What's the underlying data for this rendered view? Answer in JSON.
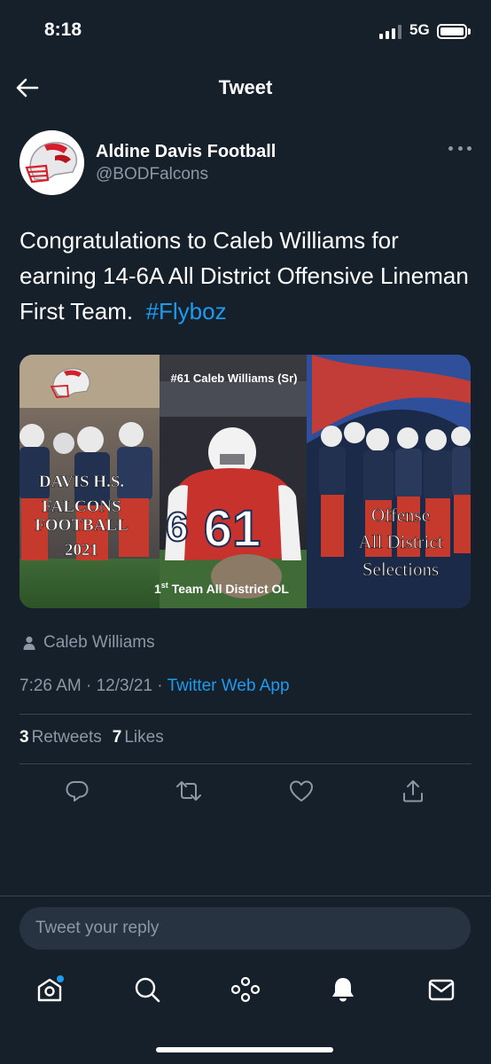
{
  "status_bar": {
    "time": "8:18",
    "network": "5G"
  },
  "nav": {
    "title": "Tweet"
  },
  "author": {
    "display_name": "Aldine Davis Football",
    "handle": "@BODFalcons"
  },
  "tweet": {
    "text_main": "Congratulations to Caleb Williams for earning 14-6A All District Offensive Lineman First Team.",
    "hashtag": "#Flyboz"
  },
  "media": {
    "caption_top": "#61 Caleb Williams (Sr)",
    "left_title": [
      "DAVIS H.S.",
      "FALCONS",
      "FOOTBALL",
      "2021"
    ],
    "jersey_number": "61",
    "jersey_side_number": "6",
    "right_title": [
      "Offense",
      "All District",
      "Selections"
    ],
    "bottom_caption_prefix": "1",
    "bottom_caption_sup": "st",
    "bottom_caption_rest": " Team All District OL"
  },
  "tagged_user": "Caleb Williams",
  "meta": {
    "time": "7:26 AM",
    "date": "12/3/21",
    "separator": " · ",
    "source": "Twitter Web App"
  },
  "stats": {
    "retweets_count": "3",
    "retweets_label": "Retweets",
    "likes_count": "7",
    "likes_label": "Likes"
  },
  "reply": {
    "placeholder": "Tweet your reply"
  },
  "icons": {
    "back": "arrow-left-icon",
    "more": "more-dots-icon",
    "reply": "reply-icon",
    "retweet": "retweet-icon",
    "like": "heart-icon",
    "share": "share-icon",
    "home": "home-icon",
    "search": "search-icon",
    "spaces": "spaces-icon",
    "notifications": "bell-icon",
    "messages": "mail-icon"
  },
  "colors": {
    "background": "#15202b",
    "accent": "#1d9bf0",
    "secondary_text": "#8b98a5",
    "divider": "#38444d"
  }
}
